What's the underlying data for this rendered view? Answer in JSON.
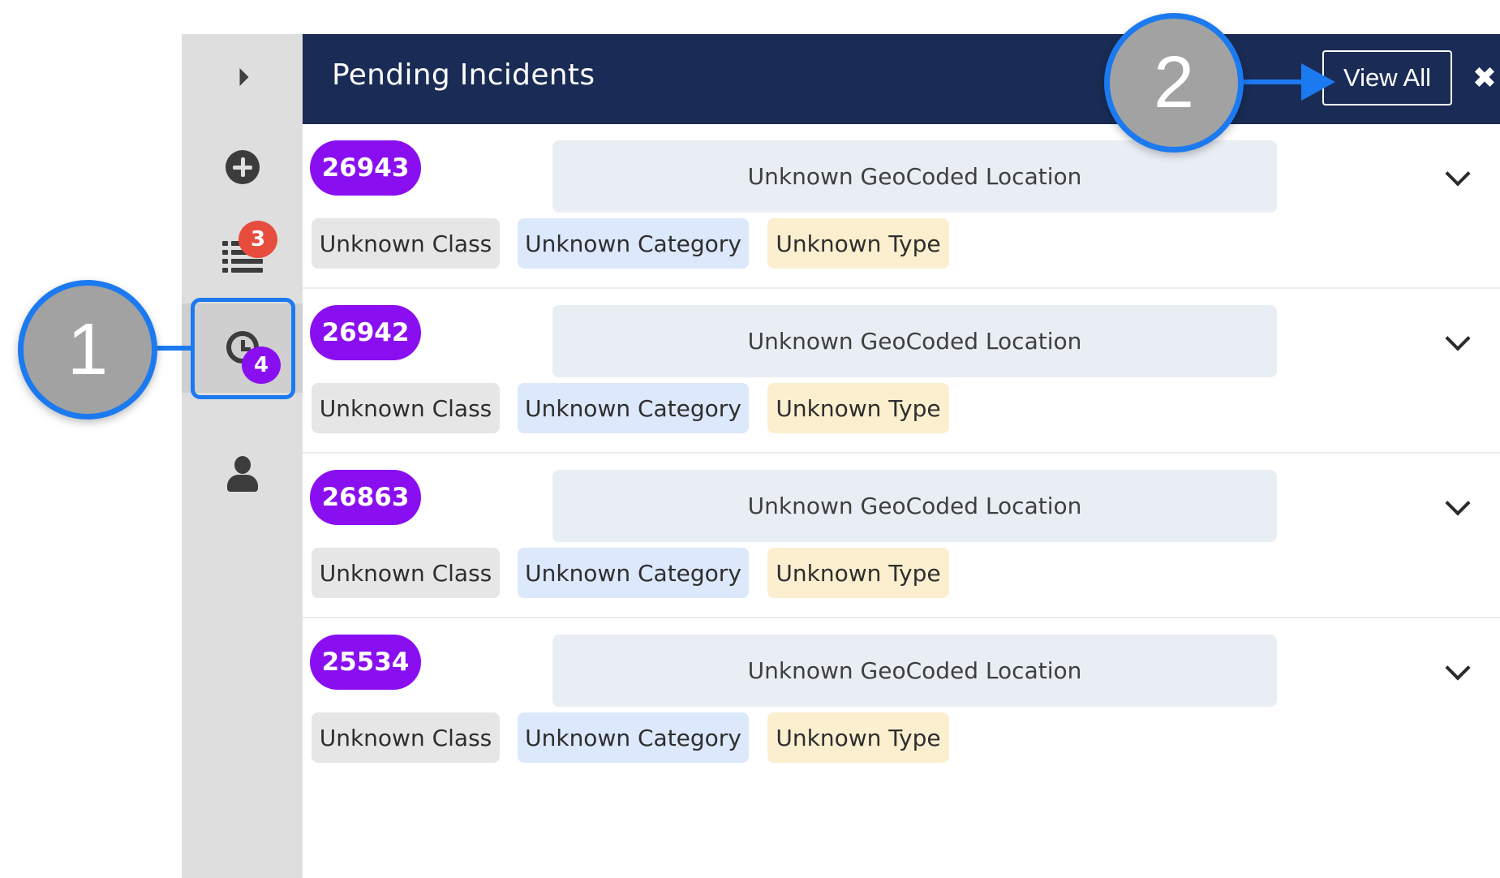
{
  "sidebar": {
    "items": [
      {
        "name": "expand",
        "icon": "caret-right-icon"
      },
      {
        "name": "new-incident",
        "icon": "plus-circle-icon"
      },
      {
        "name": "incident-list",
        "icon": "list-icon",
        "badge": "3"
      },
      {
        "name": "pending-incidents",
        "icon": "clock-icon",
        "badge": "4",
        "active": true
      },
      {
        "name": "profile",
        "icon": "user-icon"
      }
    ]
  },
  "callouts": [
    {
      "label": "1"
    },
    {
      "label": "2"
    }
  ],
  "panel": {
    "title": "Pending Incidents",
    "view_all_label": "View All",
    "close_glyph": "✖"
  },
  "incidents": [
    {
      "id": "26943",
      "location": "Unknown GeoCoded Location",
      "class": "Unknown Class",
      "category": "Unknown Category",
      "type": "Unknown Type"
    },
    {
      "id": "26942",
      "location": "Unknown GeoCoded Location",
      "class": "Unknown Class",
      "category": "Unknown Category",
      "type": "Unknown Type"
    },
    {
      "id": "26863",
      "location": "Unknown GeoCoded Location",
      "class": "Unknown Class",
      "category": "Unknown Category",
      "type": "Unknown Type"
    },
    {
      "id": "25534",
      "location": "Unknown GeoCoded Location",
      "class": "Unknown Class",
      "category": "Unknown Category",
      "type": "Unknown Type"
    }
  ],
  "colors": {
    "header_bg": "#1a2c55",
    "id_badge": "#8a0ff0",
    "callout_blue": "#1c7af0",
    "badge_red": "#e74c3c"
  }
}
